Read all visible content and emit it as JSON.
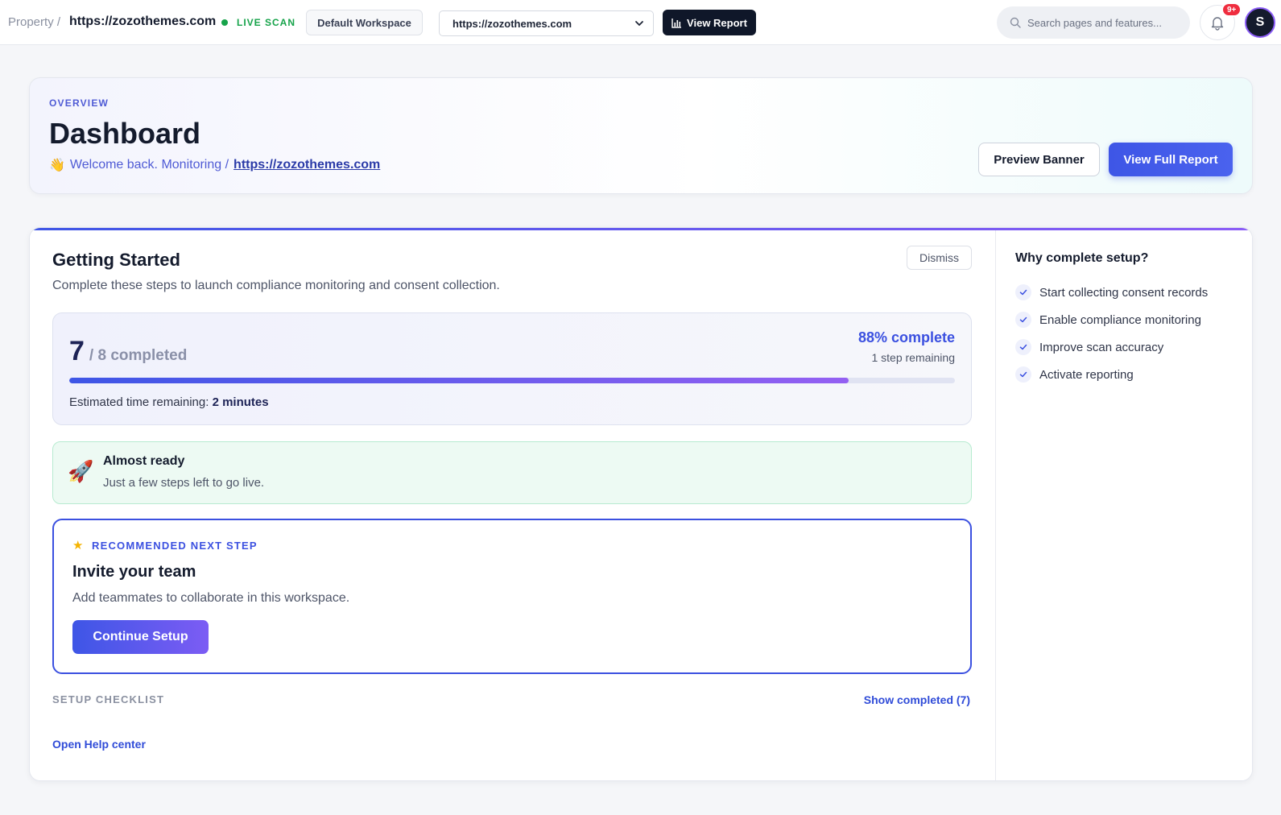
{
  "topbar": {
    "breadcrumb_prefix": "Property /",
    "site": "https://zozothemes.com",
    "live_label": "LIVE SCAN",
    "workspace_label": "Default Workspace",
    "site_select_value": "https://zozothemes.com",
    "view_report_label": "View Report",
    "search_placeholder": "Search pages and features...",
    "notification_badge": "9+",
    "avatar_initial": "S",
    "colors": {
      "live": "#16a34a",
      "badge": "#ef2d3f",
      "accent": "#3b50e0"
    },
    "icons": [
      "bar-chart-icon",
      "search-icon",
      "bell-icon",
      "chevron-down-icon"
    ]
  },
  "header": {
    "overview_label": "OVERVIEW",
    "title": "Dashboard",
    "welcome_emoji": "👋",
    "welcome_text": "Welcome back. Monitoring /",
    "welcome_link": "https://zozothemes.com",
    "preview_banner_label": "Preview Banner",
    "view_full_report_label": "View Full Report"
  },
  "getting_started": {
    "title": "Getting Started",
    "subtitle": "Complete these steps to launch compliance monitoring and consent collection.",
    "dismiss_label": "Dismiss",
    "progress": {
      "completed": "7",
      "total_text": "/ 8 completed",
      "percent_text": "88% complete",
      "percent_value": 0.88,
      "remaining_text": "1 step remaining",
      "eta_prefix": "Estimated time remaining:",
      "eta_value": "2 minutes"
    },
    "almost_ready": {
      "icon": "rocket-icon",
      "emoji": "🚀",
      "title": "Almost ready",
      "subtitle": "Just a few steps left to go live."
    },
    "next_step": {
      "icon": "star-icon",
      "label": "RECOMMENDED NEXT STEP",
      "title": "Invite your team",
      "subtitle": "Add teammates to collaborate in this workspace.",
      "button_label": "Continue Setup"
    },
    "checklist_label": "SETUP CHECKLIST",
    "show_completed_label": "Show completed (7)",
    "help_link_label": "Open Help center"
  },
  "why_setup": {
    "title": "Why complete setup?",
    "items": [
      "Start collecting consent records",
      "Enable compliance monitoring",
      "Improve scan accuracy",
      "Activate reporting"
    ]
  }
}
